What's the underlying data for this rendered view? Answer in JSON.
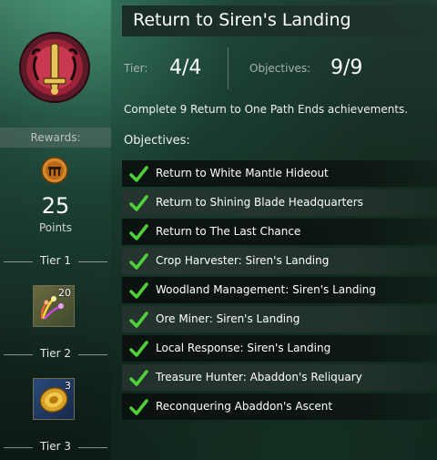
{
  "header": {
    "title": "Return to Siren's Landing",
    "tier_label": "Tier:",
    "tier_value": "4/4",
    "objectives_label": "Objectives:",
    "objectives_value": "9/9"
  },
  "description": "Complete 9 Return to One Path Ends achievements.",
  "objectives_heading": "Objectives:",
  "objectives": [
    {
      "label": "Return to White Mantle Hideout",
      "done": true
    },
    {
      "label": "Return to Shining Blade Headquarters",
      "done": true
    },
    {
      "label": "Return to The Last Chance",
      "done": true
    },
    {
      "label": "Crop Harvester: Siren's Landing",
      "done": true
    },
    {
      "label": "Woodland Management: Siren's Landing",
      "done": true
    },
    {
      "label": "Ore Miner: Siren's Landing",
      "done": true
    },
    {
      "label": "Local Response: Siren's Landing",
      "done": true
    },
    {
      "label": "Treasure Hunter: Abaddon's Reliquary",
      "done": true
    },
    {
      "label": "Reconquering Abaddon's Ascent",
      "done": true
    }
  ],
  "rewards": {
    "label": "Rewards:",
    "points_value": "25",
    "points_label": "Points",
    "tiers": [
      {
        "label": "Tier 1",
        "item_icon": "fireworks-icon",
        "count": "20"
      },
      {
        "label": "Tier 2",
        "item_icon": "gold-coin-icon",
        "count": "3"
      },
      {
        "label": "Tier 3"
      }
    ]
  },
  "colors": {
    "check_green": "#4fd23a",
    "emblem_red": "#a3243a",
    "emblem_gold": "#e2b84a"
  }
}
